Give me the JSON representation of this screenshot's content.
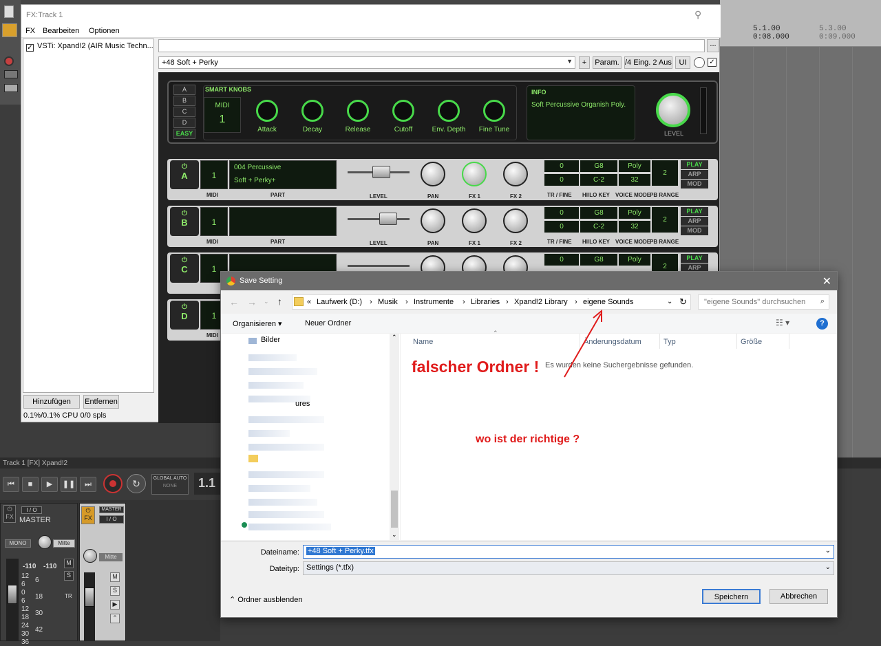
{
  "daw": {
    "timeline_markers": [
      {
        "bars": "5.1.00",
        "time": "0:08.000"
      },
      {
        "bars": "5.3.00",
        "time": "0:09.000"
      }
    ],
    "track_label": "Track 1 [FX] Xpand!2",
    "transport": {
      "global_auto": "GLOBAL AUTO",
      "none": "NONE",
      "position": "1.1"
    },
    "mixer": {
      "master": "MASTER",
      "io": "I / O",
      "mono": "MONO",
      "pan_center": "Mitte",
      "fx": "FX",
      "peak_left": "-110",
      "peak_right": "-110",
      "master_badge": "MASTER",
      "m": "M",
      "s": "S",
      "tr": "TR",
      "scale_left": [
        "12",
        "6",
        "0",
        "6",
        "12",
        "18",
        "24",
        "30",
        "36"
      ],
      "scale_mid": [
        "6",
        "18",
        "30",
        "42"
      ]
    }
  },
  "fx_window": {
    "title": "FX:Track 1",
    "menu": [
      "FX",
      "Bearbeiten",
      "Optionen"
    ],
    "plugin_entry": "VSTi: Xpand!2 (AIR Music Techn...",
    "add_button": "Hinzufügen",
    "remove_button": "Entfernen",
    "cpu_status": "0.1%/0.1% CPU 0/0 spls",
    "path_button": "...",
    "preset": "+48 Soft + Perky",
    "plus_button": "+",
    "param_button": "Param.",
    "io_button": "/4 Eing. 2 Ausg",
    "ui_button": "UI"
  },
  "plugin": {
    "abcd": [
      "A",
      "B",
      "C",
      "D"
    ],
    "easy": "EASY",
    "smart_knobs_label": "SMART KNOBS",
    "midi_label": "MIDI",
    "midi_value": "1",
    "smart_knobs": [
      "Attack",
      "Decay",
      "Release",
      "Cutoff",
      "Env. Depth",
      "Fine Tune"
    ],
    "info_label": "INFO",
    "info_text": "Soft Percussive Organish Poly.",
    "level_label": "LEVEL",
    "part_labels": {
      "midi": "MIDI",
      "part": "PART",
      "level": "LEVEL",
      "pan": "PAN",
      "fx1": "FX 1",
      "fx2": "FX 2",
      "tr_fine": "TR / FINE",
      "hi_lo_key": "HI/LO KEY",
      "voice_mode": "VOICE MODE",
      "pb_range": "PB RANGE"
    },
    "parts": [
      {
        "letter": "A",
        "midi": "1",
        "line1": "004 Percussive",
        "line2": "Soft + Perky+",
        "tr": "0",
        "fine": "0",
        "hi": "G8",
        "lo": "C-2",
        "mode": "Poly",
        "voices": "32",
        "pb": "2"
      },
      {
        "letter": "B",
        "midi": "1",
        "line1": "",
        "line2": "",
        "tr": "0",
        "fine": "0",
        "hi": "G8",
        "lo": "C-2",
        "mode": "Poly",
        "voices": "32",
        "pb": "2"
      },
      {
        "letter": "C",
        "midi": "1",
        "line1": "",
        "line2": "",
        "tr": "0",
        "fine": "",
        "hi": "G8",
        "lo": "",
        "mode": "Poly",
        "voices": "",
        "pb": "2"
      },
      {
        "letter": "D",
        "midi": "1",
        "line1": "",
        "line2": "",
        "tr": "",
        "fine": "",
        "hi": "",
        "lo": "",
        "mode": "",
        "voices": "",
        "pb": ""
      }
    ],
    "play_buttons": [
      "PLAY",
      "ARP",
      "MOD"
    ]
  },
  "save_dialog": {
    "title": "Save Setting",
    "breadcrumb": [
      "«",
      "Laufwerk (D:)",
      "Musik",
      "Instrumente",
      "Libraries",
      "Xpand!2 Library",
      "eigene Sounds"
    ],
    "search_placeholder": "\"eigene Sounds\" durchsuchen",
    "organize": "Organisieren ▾",
    "new_folder": "Neuer Ordner",
    "nav_items": [
      "Bilder",
      "ures"
    ],
    "columns": [
      "Name",
      "Änderungsdatum",
      "Typ",
      "Größe"
    ],
    "empty_message": "Es wurden keine Suchergebnisse gefunden.",
    "filename_label": "Dateiname:",
    "filename_value": "+48 Soft + Perky.tfx",
    "filetype_label": "Dateityp:",
    "filetype_value": "Settings (*.tfx)",
    "hide_folders": "Ordner ausblenden",
    "save_button": "Speichern",
    "cancel_button": "Abbrechen",
    "help": "?"
  },
  "annotations": {
    "wrong_folder": "falscher Ordner !",
    "where_right": "wo ist der richtige ?"
  },
  "colors": {
    "lcd_green": "#8eea6a",
    "annotation_red": "#e01b1b",
    "title_bar_gray": "#6b6b6b"
  }
}
